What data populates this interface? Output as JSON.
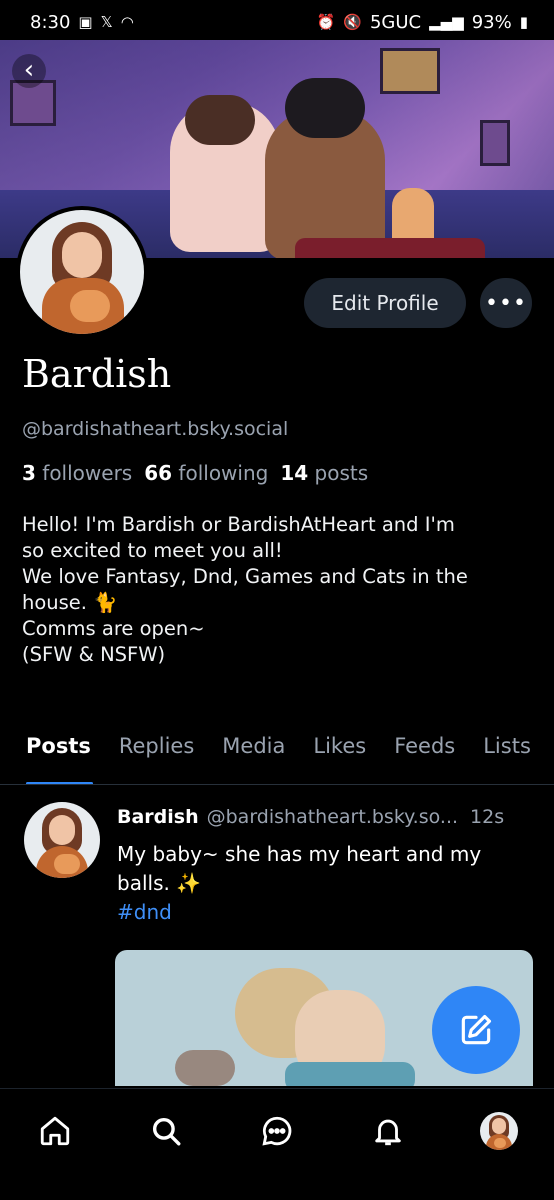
{
  "status_bar": {
    "time": "8:30",
    "network": "5GUC",
    "battery": "93%"
  },
  "profile": {
    "display_name": "Bardish",
    "handle": "@bardishatheart.bsky.social",
    "edit_label": "Edit Profile",
    "more_label": "•••",
    "stats": {
      "followers_count": "3",
      "followers_label": "followers",
      "following_count": "66",
      "following_label": "following",
      "posts_count": "14",
      "posts_label": "posts"
    },
    "bio_lines": [
      "Hello! I'm Bardish or BardishAtHeart and I'm",
      "so excited to meet you all!",
      "We love Fantasy, Dnd, Games and Cats in the",
      "house. 🐈",
      "Comms are open~",
      "(SFW & NSFW)"
    ]
  },
  "tabs": [
    {
      "label": "Posts",
      "active": true
    },
    {
      "label": "Replies",
      "active": false
    },
    {
      "label": "Media",
      "active": false
    },
    {
      "label": "Likes",
      "active": false
    },
    {
      "label": "Feeds",
      "active": false
    },
    {
      "label": "Lists",
      "active": false
    }
  ],
  "post": {
    "author": "Bardish",
    "handle": "@bardishatheart.bsky.so...",
    "time": "12s",
    "text_line1": "My baby~ she has my heart and my",
    "text_line2": "balls. ✨",
    "hashtag": "#dnd"
  },
  "nav": {
    "items": [
      "home-icon",
      "search-icon",
      "chat-icon",
      "bell-icon",
      "profile-avatar"
    ]
  },
  "colors": {
    "accent": "#2f86f6",
    "background": "#000000",
    "muted_text": "#9aa3b0",
    "button_bg": "#1e2631"
  }
}
